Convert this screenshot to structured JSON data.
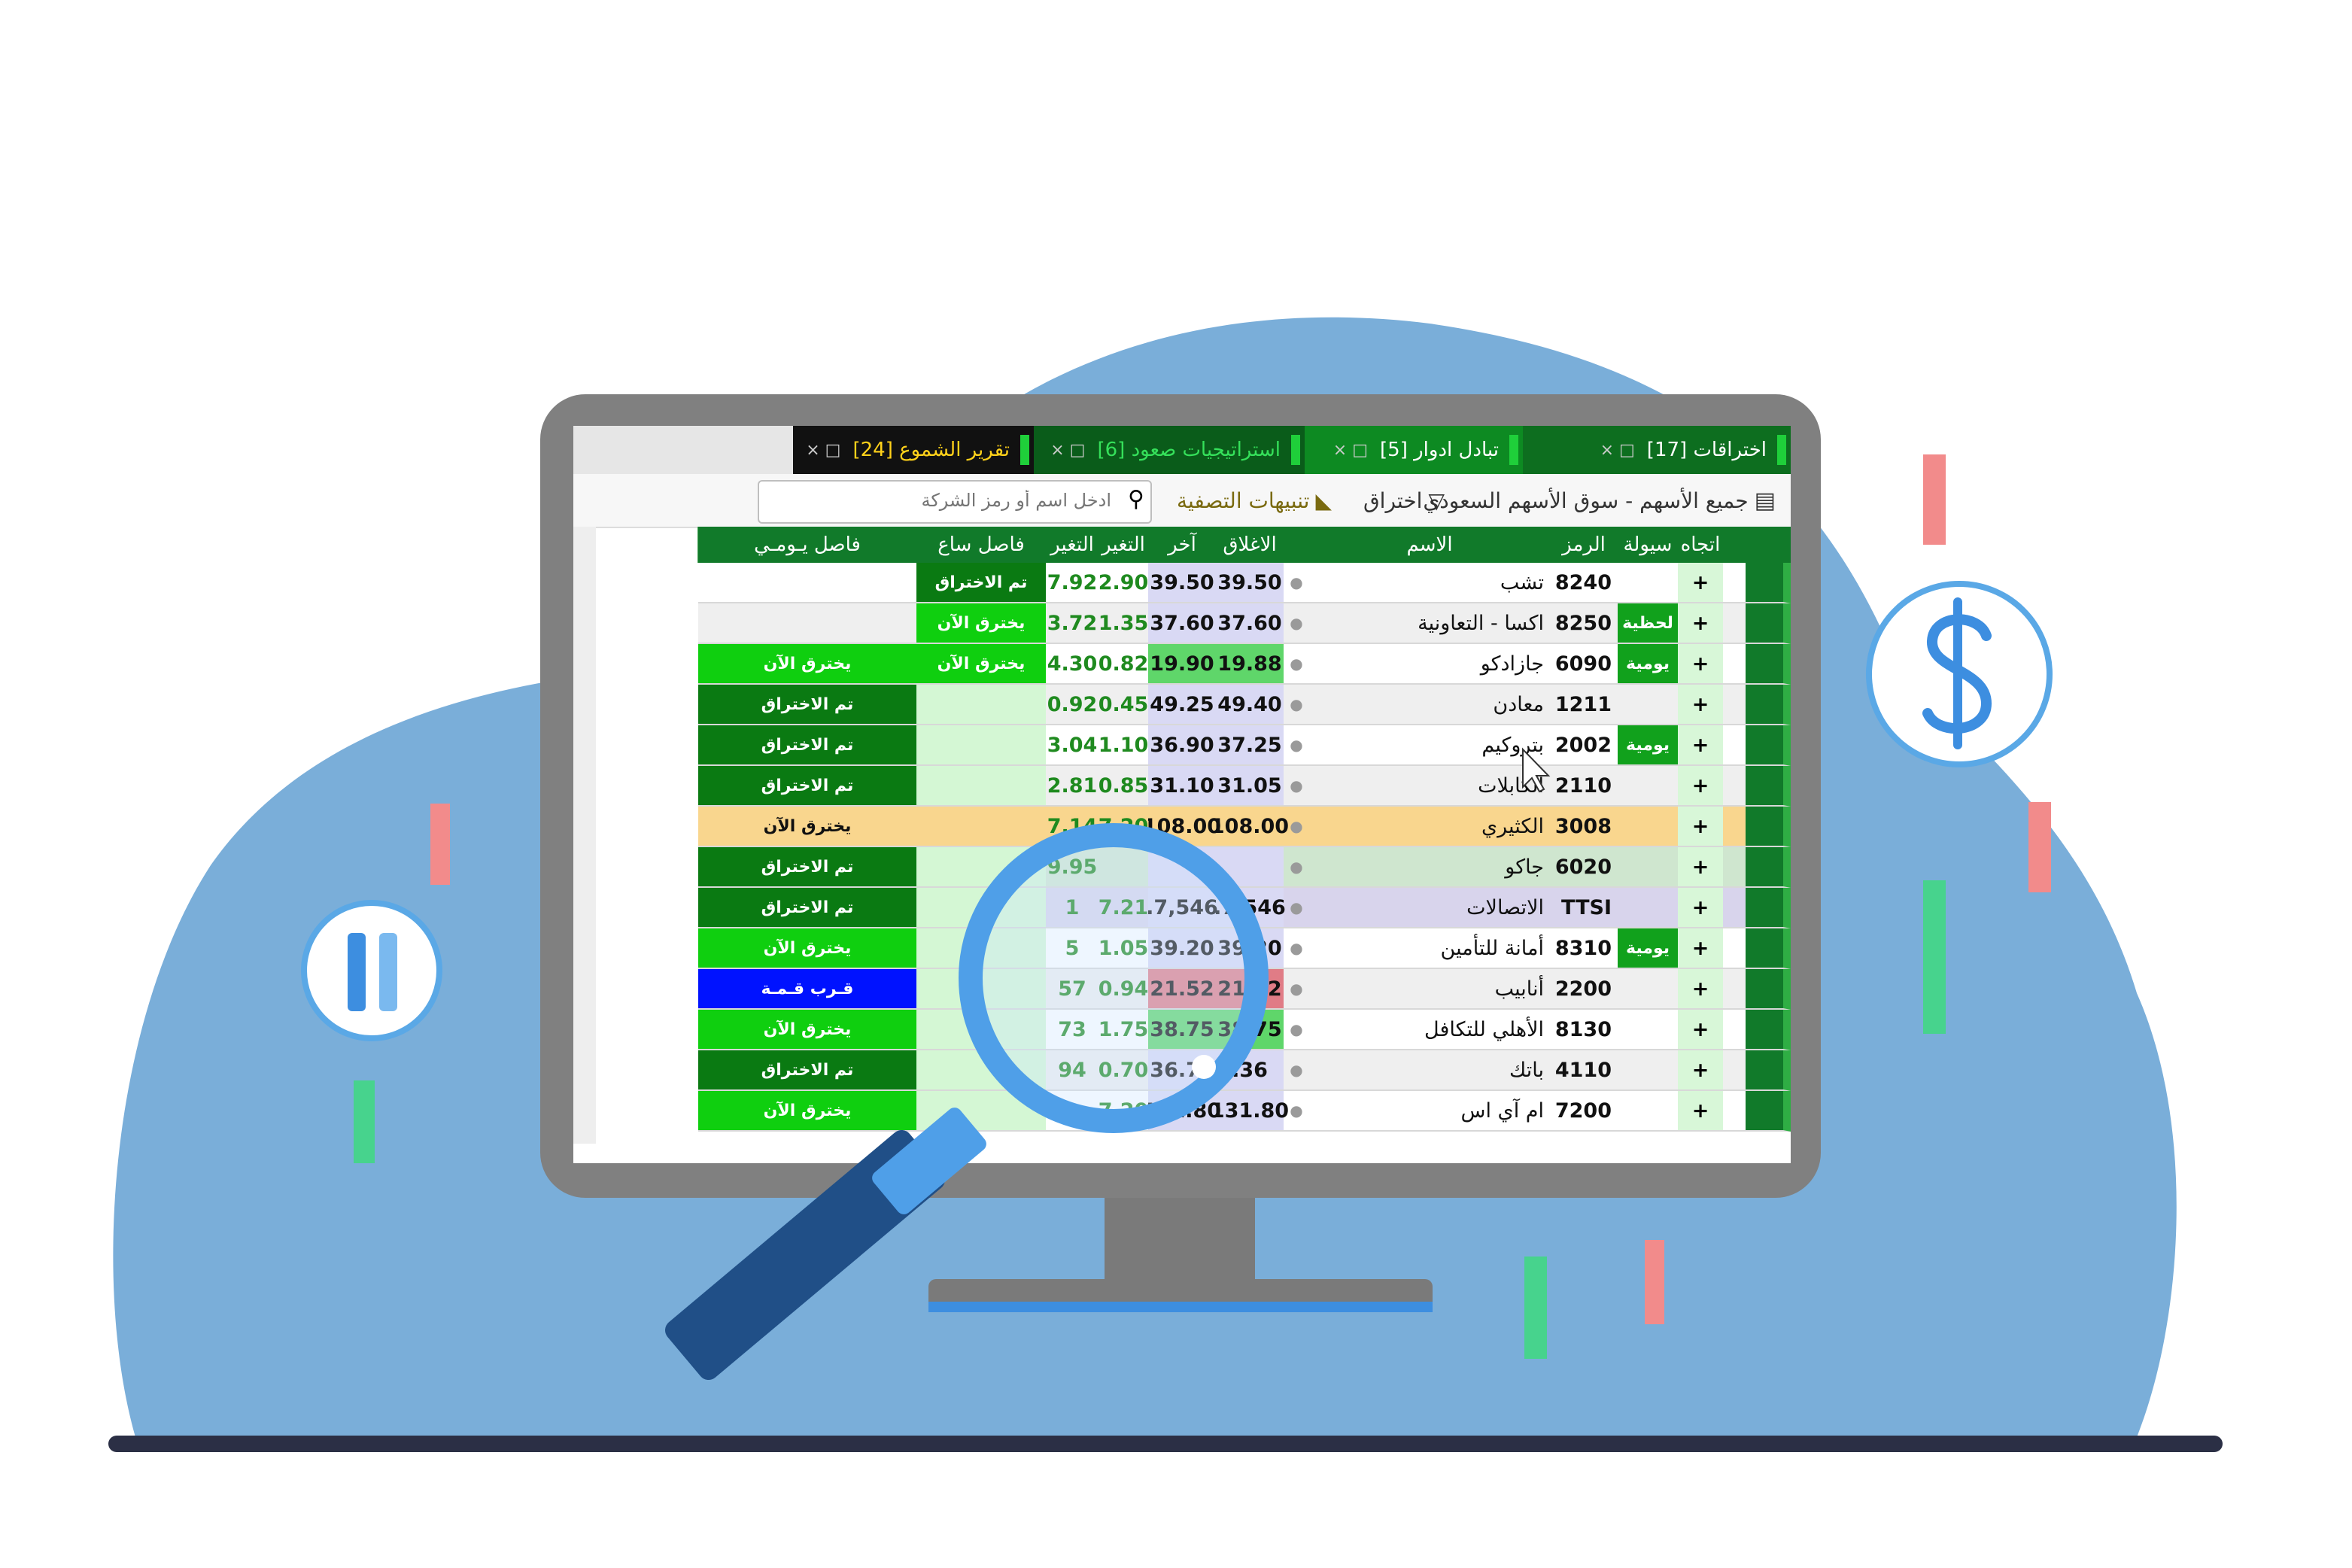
{
  "tabs": [
    {
      "label": "اختراقات [17]",
      "bg": "#0d6e1f",
      "color": "#ffffff",
      "active": false
    },
    {
      "label": "تبادل ادوار [5]",
      "bg": "#0d8a22",
      "color": "#ffffff",
      "active": false
    },
    {
      "label": "استراتيجيات صعود [6]",
      "bg": "#0a5c1a",
      "color": "#35e05a",
      "active": false
    },
    {
      "label": "تقرير الشموع [24]",
      "bg": "#111111",
      "color": "#ffd11a",
      "active": true
    }
  ],
  "toolbar": {
    "market_label": "جميع الأسهم - سوق الأسهم السعودي",
    "breakout_label": "اختراق",
    "liquidation_label": "تنبيهات التصفية",
    "search_placeholder": "ادخل اسم أو رمز الشركة"
  },
  "columns": [
    "اتجاه",
    "سيولة",
    "الرمز",
    "الاسم",
    "الاغلاق",
    "آخر",
    "التغير",
    "التغير",
    "فاصل ساع",
    "فاصل يـومـي"
  ],
  "rows": [
    {
      "code": "8240",
      "name": "تشب",
      "liq": "",
      "close": "39.50",
      "last": "39.50",
      "chg": "2.90",
      "pct": "7.92",
      "hourly": "تم الاختراق",
      "daily": "",
      "bg": "#ffffff"
    },
    {
      "code": "8250",
      "name": "اكسا - التعاونية",
      "liq": "لحظية",
      "close": "37.60",
      "last": "37.60",
      "chg": "1.35",
      "pct": "3.72",
      "hourly": "يخترق الآن",
      "daily": "",
      "bg": "#efefef"
    },
    {
      "code": "6090",
      "name": "جازادكو",
      "liq": "يومية",
      "close": "19.88",
      "last": "19.90",
      "chg": "0.82",
      "pct": "4.30",
      "hourly": "يخترق الآن",
      "daily": "يخترق الآن",
      "bg": "#ffffff"
    },
    {
      "code": "1211",
      "name": "معادن",
      "liq": "",
      "close": "49.40",
      "last": "49.25",
      "chg": "0.45",
      "pct": "0.92",
      "hourly": "",
      "daily": "تم الاختراق",
      "bg": "#efefef"
    },
    {
      "code": "2002",
      "name": "بتروكيم",
      "liq": "يومية",
      "close": "37.25",
      "last": "36.90",
      "chg": "1.10",
      "pct": "3.04",
      "hourly": "",
      "daily": "تم الاختراق",
      "bg": "#ffffff"
    },
    {
      "code": "2110",
      "name": "الكابلات",
      "liq": "",
      "close": "31.05",
      "last": "31.10",
      "chg": "0.85",
      "pct": "2.81",
      "hourly": "",
      "daily": "تم الاختراق",
      "bg": "#efefef"
    },
    {
      "code": "3008",
      "name": "الكثيري",
      "liq": "",
      "close": "108.00",
      "last": "108.00",
      "chg": "7.20",
      "pct": "7.14",
      "hourly": "",
      "daily": "يخترق الآن",
      "bg": "#f9d68e"
    },
    {
      "code": "6020",
      "name": "جاكو",
      "liq": "",
      "close": "",
      "last": "",
      "chg": "",
      "pct": "9.95",
      "hourly": "",
      "daily": "تم الاختراق",
      "bg": "#cfe6cf"
    },
    {
      "code": "TTSI",
      "name": "الاتصالات",
      "liq": "",
      "close": "7,546.",
      "last": "7,546.",
      "chg": "7.21",
      "pct": "1",
      "hourly": "",
      "daily": "تم الاختراق",
      "bg": "#d8d4ec"
    },
    {
      "code": "8310",
      "name": "أمانة للتأمين",
      "liq": "يومية",
      "close": "39.20",
      "last": "39.20",
      "chg": "1.05",
      "pct": "5",
      "hourly": "",
      "daily": "يخترق الآن",
      "bg": "#ffffff"
    },
    {
      "code": "2200",
      "name": "أنابيب",
      "liq": "",
      "close": "21.52",
      "last": "21.52",
      "chg": "0.94",
      "pct": "57",
      "hourly": "",
      "daily": "قـرب قـمـة",
      "bg": "#efefef"
    },
    {
      "code": "8130",
      "name": "الأهلي للتكافل",
      "liq": "",
      "close": "38.75",
      "last": "38.75",
      "chg": "1.75",
      "pct": "73",
      "hourly": "",
      "daily": "يخترق الآن",
      "bg": "#ffffff"
    },
    {
      "code": "4110",
      "name": "باتك",
      "liq": "",
      "close": "36.",
      "last": "36.70",
      "chg": "0.70",
      "pct": "94",
      "hourly": "",
      "daily": "تم الاختراق",
      "bg": "#efefef"
    },
    {
      "code": "7200",
      "name": "ام آي اس",
      "liq": "",
      "close": "131.80",
      "last": "131.80",
      "chg": "7.20",
      "pct": "",
      "hourly": "",
      "daily": "يخترق الآن",
      "bg": "#ffffff"
    }
  ],
  "direction_symbol": "+",
  "colors": {
    "header": "#117a2a",
    "status_done": "#0a7a12",
    "status_now": "#0fcf0f",
    "status_near": "#0012ff",
    "background_blob": "#7aaed9",
    "candle_red": "#f28b8b",
    "candle_green": "#47d38d",
    "monitor_frame": "#808080",
    "magnifier_ring": "#4f9fe8",
    "magnifier_handle": "#204f87"
  },
  "icons": [
    "dollar-icon",
    "pause-icon",
    "magnifier-icon",
    "cursor-icon",
    "search-icon",
    "filter-icon",
    "bell-icon",
    "sheet-icon",
    "flag-icon",
    "trend-icon"
  ]
}
